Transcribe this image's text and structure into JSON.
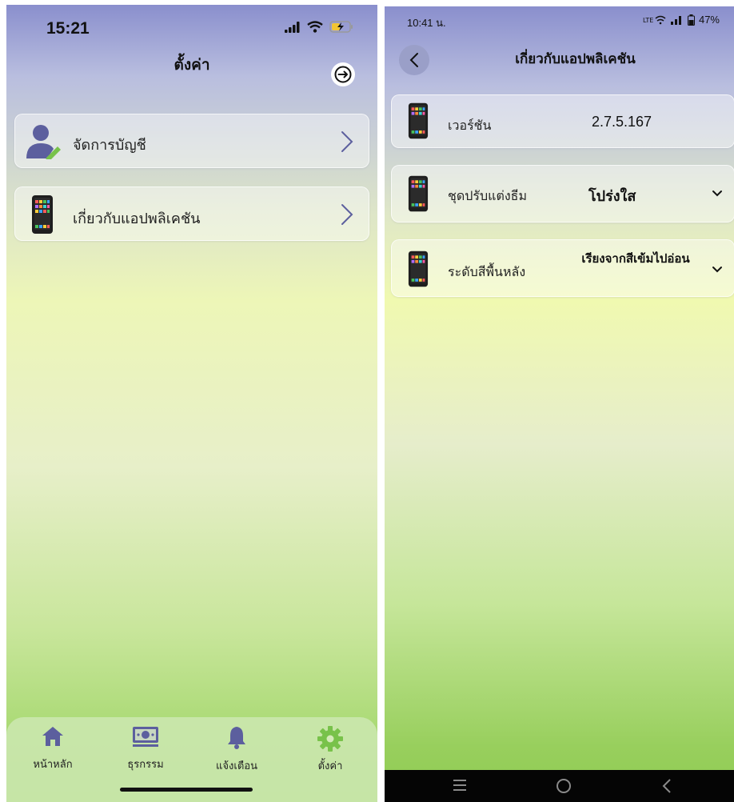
{
  "left_screen": {
    "status_bar": {
      "time": "15:21"
    },
    "title": "ตั้งค่า",
    "logout_icon": "logout-arrow-icon",
    "menu_items": [
      {
        "label": "จัดการบัญชี",
        "icon": "user-edit-icon"
      },
      {
        "label": "เกี่ยวกับแอปพลิเคชัน",
        "icon": "smartphone-icon"
      }
    ],
    "tab_bar": {
      "tabs": [
        {
          "label": "หน้าหลัก",
          "icon": "home-icon"
        },
        {
          "label": "ธุรกรรม",
          "icon": "banknote-icon"
        },
        {
          "label": "แจ้งเตือน",
          "icon": "bell-icon"
        },
        {
          "label": "ตั้งค่า",
          "icon": "gear-icon"
        }
      ]
    }
  },
  "right_screen": {
    "status_bar": {
      "time": "10:41 น.",
      "battery": "47%"
    },
    "title": "เกี่ยวกับแอปพลิเคชัน",
    "rows": [
      {
        "label": "เวอร์ชัน",
        "value": "2.7.5.167"
      },
      {
        "label": "ชุดปรับแต่งธีม",
        "value": "โปร่งใส"
      },
      {
        "label": "ระดับสีพื้นหลัง",
        "value": "เรียงจากสีเข้มไปอ่อน"
      }
    ]
  },
  "colors": {
    "accent": "#5c5f9e",
    "icon_green": "#78c24a",
    "gradient_top": "#8a8fcd",
    "gradient_bottom": "#9fd468"
  }
}
